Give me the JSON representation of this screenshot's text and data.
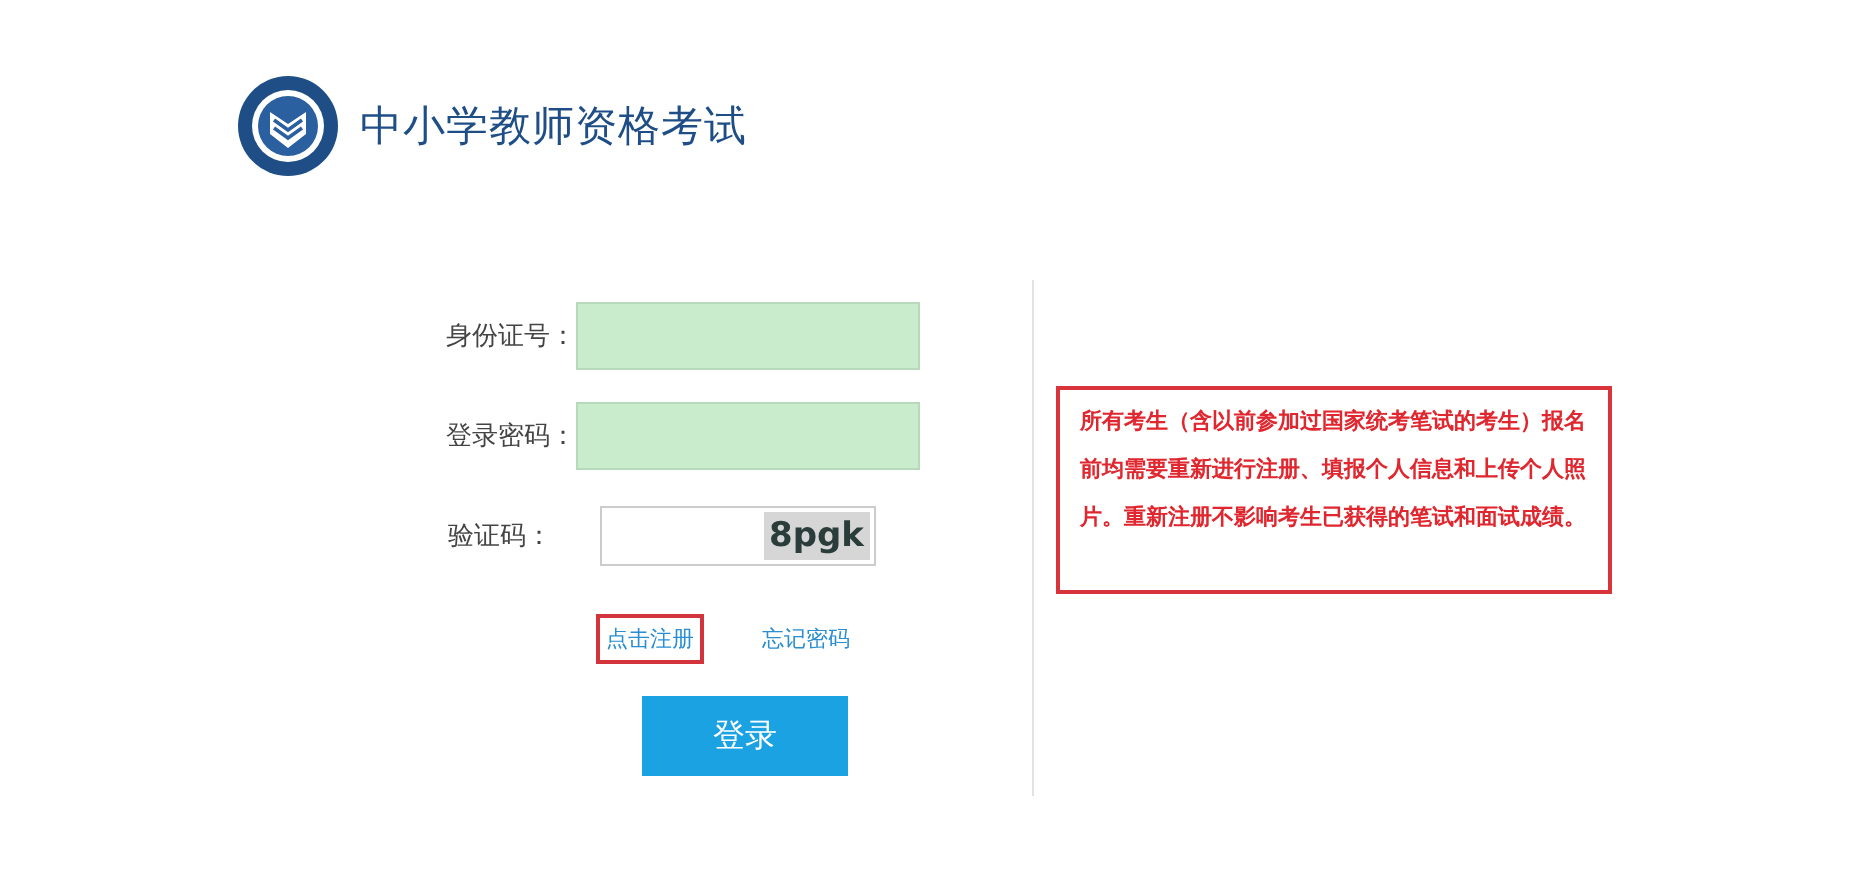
{
  "header": {
    "title": "中小学教师资格考试"
  },
  "form": {
    "fields": [
      {
        "label": "身份证号：",
        "kind": "text"
      },
      {
        "label": "登录密码：",
        "kind": "text"
      },
      {
        "label": "验证码：",
        "kind": "captcha",
        "captcha": "8pgk"
      }
    ],
    "links": [
      {
        "label": "点击注册",
        "highlighted": true
      },
      {
        "label": "忘记密码",
        "highlighted": false
      }
    ],
    "submit": "登录"
  },
  "notice": {
    "text": "所有考生（含以前参加过国家统考笔试的考生）报名前均需要重新进行注册、填报个人信息和上传个人照片。重新注册不影响考生已获得的笔试和面试成绩。",
    "highlighted": true
  }
}
